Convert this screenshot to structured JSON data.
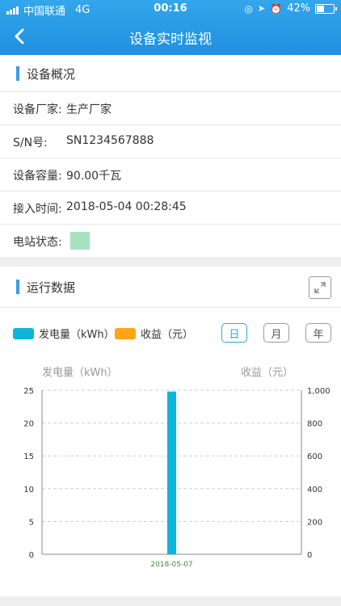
{
  "status_bar": {
    "carrier": "中国联通",
    "network": "4G",
    "time": "00:16",
    "battery": "42%"
  },
  "nav": {
    "title": "设备实时监视"
  },
  "overview": {
    "title": "设备概况",
    "manufacturer_label": "设备厂家:",
    "manufacturer_value": "生产厂家",
    "sn_label": "S/N号:",
    "sn_value": "SN1234567888",
    "capacity_label": "设备容量:",
    "capacity_value": "90.00千瓦",
    "access_label": "接入时间:",
    "access_value": "2018-05-04 00:28:45",
    "station_label": "电站状态:",
    "station_color": "#a8e2c0"
  },
  "running": {
    "title": "运行数据",
    "legend": {
      "generation": "发电量（kWh）",
      "revenue": "收益（元）"
    },
    "periods": {
      "day": "日",
      "month": "月",
      "year": "年"
    },
    "colors": {
      "generation": "#0fb4d9",
      "revenue": "#ffa412"
    }
  },
  "chart_data": {
    "type": "bar",
    "categories": [
      "2018-05-07"
    ],
    "series": [
      {
        "name": "发电量（kWh）",
        "values": [
          24.8
        ],
        "axis": "left"
      },
      {
        "name": "收益（元）",
        "values": [
          0
        ],
        "axis": "right"
      }
    ],
    "ylabel": "发电量（kWh）",
    "y2label": "收益（元）",
    "ylim": [
      0,
      25
    ],
    "y2lim": [
      0,
      1000
    ],
    "yticks": [
      "0",
      "5",
      "10",
      "15",
      "20",
      "25"
    ],
    "y2ticks": [
      "0",
      "200",
      "400",
      "600",
      "800",
      "1,000"
    ],
    "grid": true
  }
}
